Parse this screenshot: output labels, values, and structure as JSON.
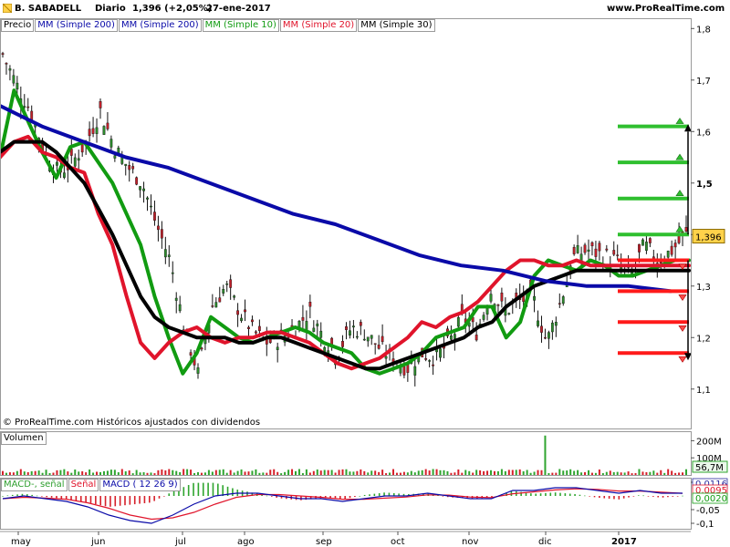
{
  "header": {
    "instrument": "B. SABADELL",
    "period": "Diario",
    "price_change": "1,396 (+2,05%)",
    "date": "27-ene-2017",
    "site": "www.ProRealTime.com"
  },
  "legend": [
    {
      "label": "Precio",
      "color": "#000000"
    },
    {
      "label": "MM (Simple 200)",
      "color": "#0a0aa8"
    },
    {
      "label": "MM (Simple 200)",
      "color": "#0a0aa8"
    },
    {
      "label": "MM (Simple 10)",
      "color": "#119b11"
    },
    {
      "label": "MM (Simple 20)",
      "color": "#e0142b"
    },
    {
      "label": "MM (Simple 30)",
      "color": "#000000"
    }
  ],
  "copyright": "© ProRealTime.com Históricos ajustados con dividendos",
  "volume_panel": {
    "label": "Volumen",
    "ticks": [
      "200M",
      "100M"
    ],
    "current": "56,7M"
  },
  "macd_panel": {
    "labels": [
      {
        "text": "MACD-, señal",
        "color": "#2f9f2f"
      },
      {
        "text": "Señal",
        "color": "#e0142b"
      },
      {
        "text": "MACD ( 12 26 9)",
        "color": "#0a0aa8"
      }
    ],
    "ticks": [
      "0,05",
      "-0,05",
      "-0,1"
    ],
    "readouts": [
      {
        "text": "0,0116",
        "color": "#2a2a9f"
      },
      {
        "text": "0,0095",
        "color": "#e0142b"
      },
      {
        "text": "0,0020",
        "color": "#119b11"
      }
    ]
  },
  "x_axis_labels": [
    "may",
    "jun",
    "jul",
    "ago",
    "sep",
    "oct",
    "nov",
    "dic",
    "2017"
  ],
  "chart_data": {
    "type": "line",
    "price_axis": {
      "ylim": [
        1.05,
        1.82
      ],
      "ticks": [
        1.1,
        1.2,
        1.3,
        1.4,
        1.5,
        1.6,
        1.7,
        1.8
      ],
      "tick_labels": [
        "1,1",
        "1,2",
        "1,3",
        "1,4",
        "1,5",
        "1,6",
        "1,7",
        "1,8"
      ]
    },
    "current_price": 1.396,
    "current_price_label": "1,396",
    "months": [
      "may",
      "jun",
      "jul",
      "ago",
      "sep",
      "oct",
      "nov",
      "dic",
      "2017"
    ],
    "series": [
      {
        "name": "Precio",
        "color": "#000000",
        "values": [
          1.75,
          1.69,
          1.64,
          1.56,
          1.52,
          1.54,
          1.58,
          1.64,
          1.57,
          1.53,
          1.5,
          1.42,
          1.35,
          1.22,
          1.13,
          1.26,
          1.3,
          1.25,
          1.21,
          1.19,
          1.2,
          1.22,
          1.25,
          1.2,
          1.17,
          1.22,
          1.21,
          1.18,
          1.16,
          1.14,
          1.17,
          1.16,
          1.19,
          1.24,
          1.21,
          1.29,
          1.25,
          1.27,
          1.28,
          1.19,
          1.27,
          1.36,
          1.37,
          1.36,
          1.35,
          1.32,
          1.38,
          1.35,
          1.37,
          1.4
        ]
      },
      {
        "name": "MM (Simple 10)",
        "color": "#119b11",
        "values": [
          1.55,
          1.68,
          1.62,
          1.56,
          1.51,
          1.57,
          1.58,
          1.54,
          1.5,
          1.44,
          1.38,
          1.28,
          1.2,
          1.13,
          1.17,
          1.24,
          1.22,
          1.2,
          1.19,
          1.2,
          1.21,
          1.22,
          1.21,
          1.19,
          1.18,
          1.17,
          1.14,
          1.13,
          1.14,
          1.15,
          1.17,
          1.2,
          1.21,
          1.22,
          1.26,
          1.26,
          1.2,
          1.23,
          1.32,
          1.35,
          1.34,
          1.33,
          1.35,
          1.34,
          1.32,
          1.32,
          1.33,
          1.34,
          1.35,
          1.35
        ]
      },
      {
        "name": "MM (Simple 20)",
        "color": "#e0142b",
        "values": [
          1.55,
          1.58,
          1.59,
          1.56,
          1.55,
          1.53,
          1.52,
          1.44,
          1.38,
          1.28,
          1.19,
          1.16,
          1.19,
          1.21,
          1.22,
          1.2,
          1.19,
          1.2,
          1.2,
          1.21,
          1.21,
          1.2,
          1.19,
          1.17,
          1.15,
          1.14,
          1.15,
          1.16,
          1.18,
          1.2,
          1.23,
          1.22,
          1.24,
          1.25,
          1.27,
          1.3,
          1.33,
          1.35,
          1.35,
          1.34,
          1.34,
          1.35,
          1.34,
          1.34,
          1.34,
          1.34,
          1.34,
          1.34,
          1.34,
          1.34
        ]
      },
      {
        "name": "MM (Simple 30)",
        "color": "#000000",
        "values": [
          1.56,
          1.58,
          1.58,
          1.58,
          1.56,
          1.53,
          1.5,
          1.45,
          1.4,
          1.34,
          1.28,
          1.24,
          1.22,
          1.21,
          1.2,
          1.2,
          1.2,
          1.19,
          1.19,
          1.2,
          1.2,
          1.19,
          1.18,
          1.17,
          1.16,
          1.15,
          1.14,
          1.14,
          1.15,
          1.16,
          1.17,
          1.18,
          1.19,
          1.2,
          1.22,
          1.23,
          1.26,
          1.28,
          1.3,
          1.31,
          1.32,
          1.33,
          1.33,
          1.33,
          1.33,
          1.33,
          1.33,
          1.33,
          1.33,
          1.33
        ]
      },
      {
        "name": "MM (Simple 200)",
        "color": "#0a0aa8",
        "values": [
          1.65,
          1.61,
          1.58,
          1.55,
          1.53,
          1.5,
          1.47,
          1.44,
          1.42,
          1.39,
          1.36,
          1.34,
          1.33,
          1.31,
          1.3,
          1.3,
          1.29
        ]
      }
    ],
    "targets": {
      "resistances_green": [
        1.61,
        1.54,
        1.47,
        1.4
      ],
      "supports_red": [
        1.35,
        1.29,
        1.23,
        1.17
      ]
    },
    "volume": {
      "ylim": [
        0,
        250
      ],
      "unit": "M",
      "spike": 230,
      "current": 56.7
    },
    "macd": {
      "ylim": [
        -0.12,
        0.06
      ],
      "macd": [
        -0.01,
        0.0,
        -0.01,
        -0.02,
        -0.04,
        -0.07,
        -0.09,
        -0.1,
        -0.07,
        -0.03,
        0.0,
        0.01,
        0.01,
        0.0,
        -0.01,
        -0.01,
        -0.02,
        -0.01,
        0.0,
        0.0,
        0.01,
        0.0,
        -0.01,
        -0.01,
        0.02,
        0.02,
        0.03,
        0.03,
        0.02,
        0.01,
        0.02,
        0.01,
        0.01
      ],
      "signal": [
        -0.01,
        -0.005,
        -0.008,
        -0.012,
        -0.025,
        -0.045,
        -0.07,
        -0.085,
        -0.08,
        -0.06,
        -0.03,
        -0.005,
        0.005,
        0.005,
        0.0,
        -0.005,
        -0.012,
        -0.012,
        -0.008,
        -0.004,
        0.004,
        0.003,
        -0.004,
        -0.006,
        0.008,
        0.015,
        0.022,
        0.026,
        0.024,
        0.018,
        0.018,
        0.014,
        0.0095
      ]
    }
  }
}
